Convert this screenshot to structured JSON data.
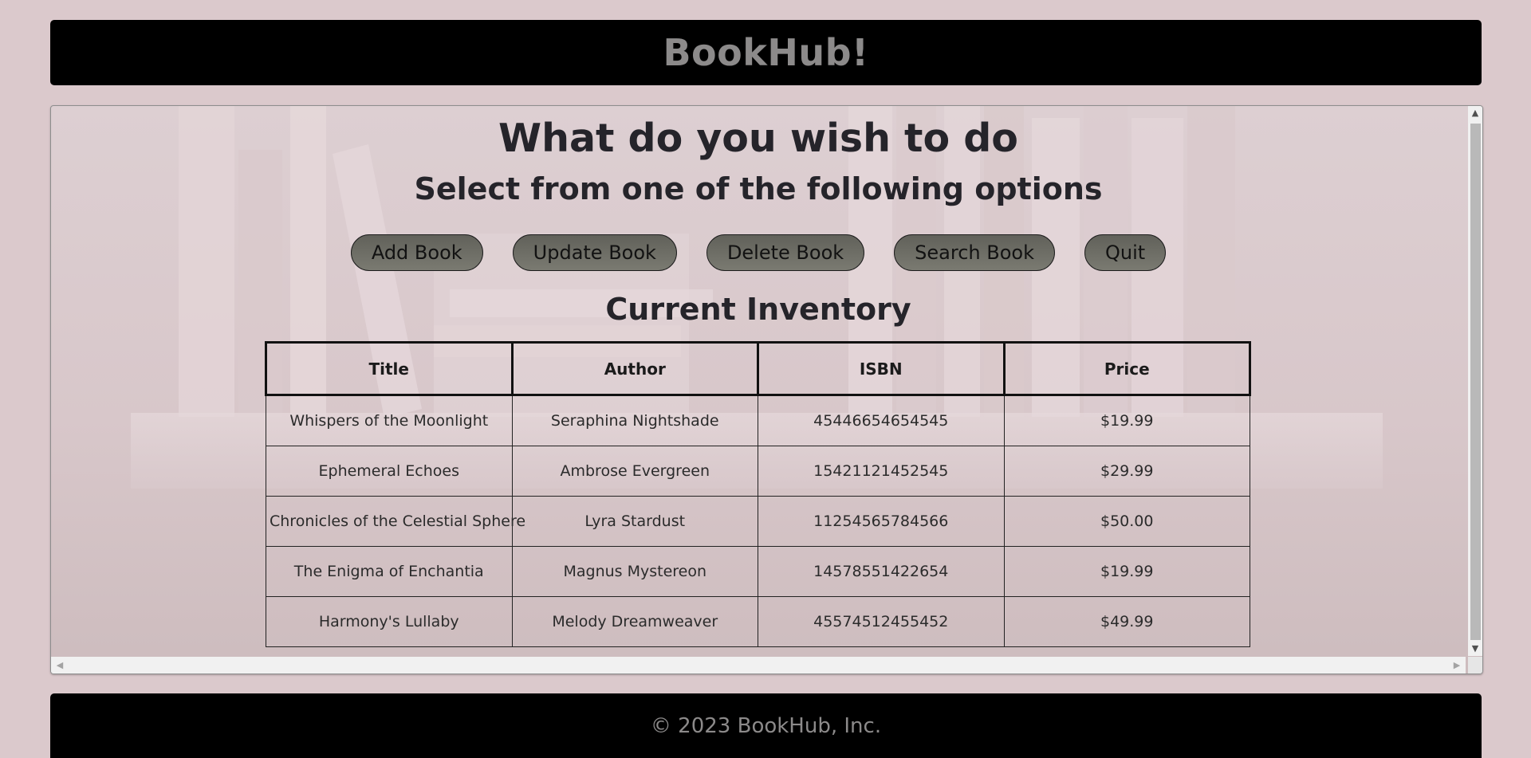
{
  "header": {
    "title": "BookHub!"
  },
  "main": {
    "heading": "What do you wish to do",
    "subheading": "Select from one of the following options",
    "buttons": {
      "add": "Add Book",
      "update": "Update Book",
      "delete": "Delete Book",
      "search": "Search Book",
      "quit": "Quit"
    },
    "inventory_title": "Current Inventory",
    "table": {
      "columns": [
        "Title",
        "Author",
        "ISBN",
        "Price"
      ],
      "rows": [
        [
          "Whispers of the Moonlight",
          "Seraphina Nightshade",
          "45446654654545",
          "$19.99"
        ],
        [
          "Ephemeral Echoes",
          "Ambrose Evergreen",
          "15421121452545",
          "$29.99"
        ],
        [
          "Chronicles of the Celestial Sphere",
          "Lyra Stardust",
          "11254565784566",
          "$50.00"
        ],
        [
          "The Enigma of Enchantia",
          "Magnus Mystereon",
          "14578551422654",
          "$19.99"
        ],
        [
          "Harmony's Lullaby",
          "Melody Dreamweaver",
          "45574512455452",
          "$49.99"
        ]
      ]
    }
  },
  "scrollbar_icons": {
    "up": "up-arrow-icon",
    "down": "down-arrow-icon",
    "left": "left-arrow-icon",
    "right": "right-arrow-icon"
  },
  "footer": {
    "text": "© 2023 BookHub, Inc."
  },
  "colors": {
    "page_bg": "#dbc9cc",
    "bar_bg": "#000000",
    "bar_text": "#8c8a8a",
    "button_bg": "#6d6d65"
  }
}
